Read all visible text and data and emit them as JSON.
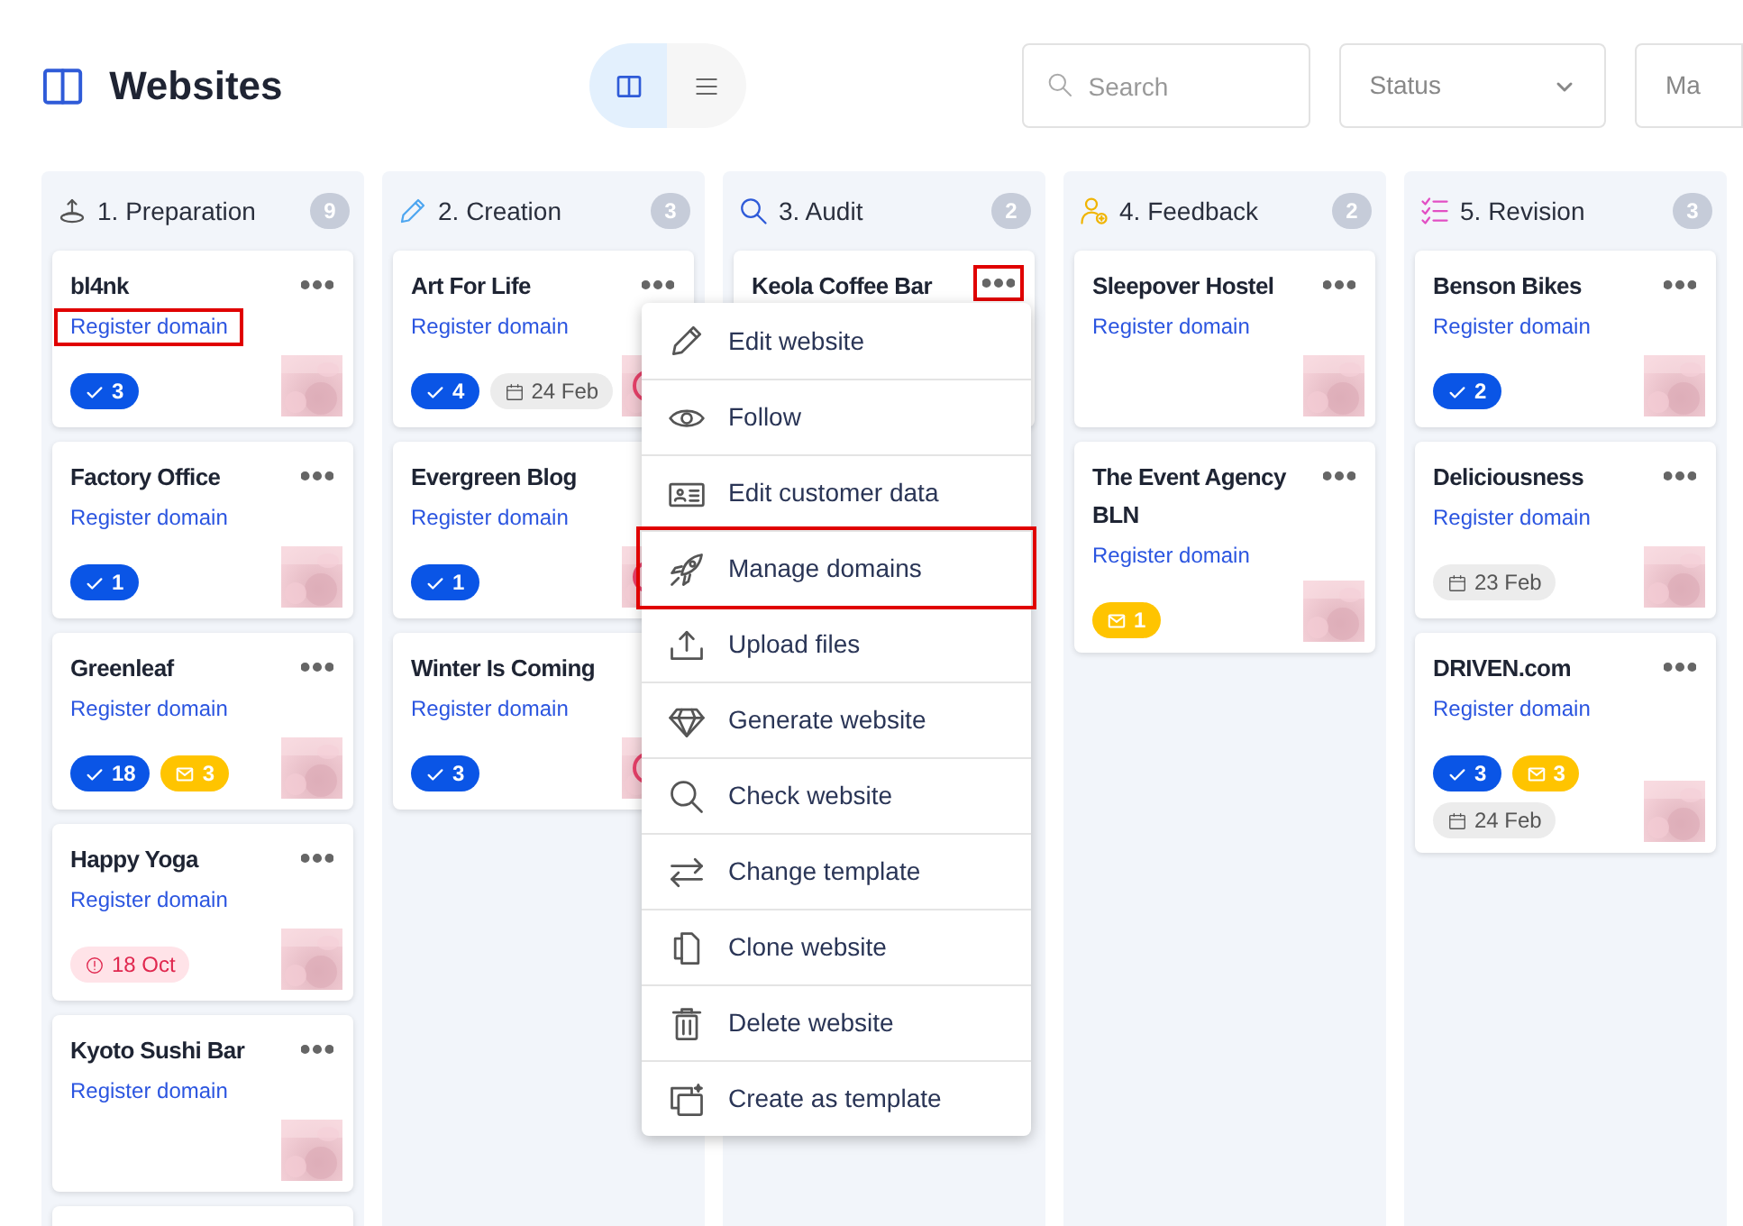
{
  "header": {
    "title": "Websites",
    "view_toggle": [
      {
        "kind": "board",
        "selected": true
      },
      {
        "kind": "list",
        "selected": false
      }
    ],
    "search": {
      "placeholder": "Search"
    },
    "status_filter": {
      "value": "Status"
    },
    "filter_3": {
      "value": "Ma"
    }
  },
  "columns": [
    {
      "title": "1. Preparation",
      "count": "9",
      "cards": [
        {
          "kind": "website",
          "title": "bl4nk",
          "link": "Register domain",
          "link_highlighted": true,
          "badges": [
            {
              "kind": "tasks",
              "text": "3"
            }
          ]
        },
        {
          "kind": "website",
          "title": "Factory Office",
          "link": "Register domain",
          "badges": [
            {
              "kind": "tasks",
              "text": "1"
            }
          ]
        },
        {
          "kind": "website",
          "title": "Greenleaf",
          "link": "Register domain",
          "badges": [
            {
              "kind": "tasks",
              "text": "18"
            },
            {
              "kind": "messages",
              "text": "3"
            }
          ]
        },
        {
          "kind": "website",
          "title": "Happy Yoga",
          "link": "Register domain",
          "badges": [
            {
              "kind": "overdue",
              "text": "18 Oct"
            }
          ]
        },
        {
          "kind": "website",
          "title": "Kyoto Sushi Bar",
          "link": "Register domain"
        },
        {
          "kind": "peek"
        }
      ]
    },
    {
      "title": "2. Creation",
      "count": "3",
      "cards": [
        {
          "kind": "website",
          "title": "Art For Life",
          "link": "Register domain",
          "badges": [
            {
              "kind": "tasks",
              "text": "4"
            },
            {
              "kind": "date",
              "text": "24 Feb"
            }
          ]
        },
        {
          "kind": "website",
          "covered": true,
          "title": "Evergreen Blog",
          "link": "Register domain",
          "badges": [
            {
              "kind": "tasks",
              "text": "1"
            }
          ]
        },
        {
          "kind": "website",
          "covered": true,
          "title": "Winter Is Coming",
          "link": "Register domain",
          "badges": [
            {
              "kind": "tasks",
              "text": "3"
            }
          ]
        }
      ]
    },
    {
      "title": "3. Audit",
      "count": "2",
      "cards": [
        {
          "kind": "website",
          "title": "Keola Coffee Bar",
          "menu_open": true
        }
      ]
    },
    {
      "title": "4. Feedback",
      "count": "2",
      "cards": [
        {
          "kind": "website",
          "title": "Sleepover Hostel",
          "link": "Register domain"
        },
        {
          "kind": "website",
          "title": "The Event Agency BLN",
          "link": "Register domain",
          "badges": [
            {
              "kind": "messages",
              "text": "1"
            }
          ]
        }
      ]
    },
    {
      "title": "5. Revision",
      "count": "3",
      "cards": [
        {
          "kind": "website",
          "title": "Benson Bikes",
          "link": "Register domain",
          "badges": [
            {
              "kind": "tasks",
              "text": "2"
            }
          ]
        },
        {
          "kind": "website",
          "title": "Deliciousness",
          "link": "Register domain",
          "badges": [
            {
              "kind": "date",
              "text": "23 Feb"
            }
          ]
        },
        {
          "kind": "website",
          "title": "DRIVEN.com",
          "link": "Register domain",
          "badges": [
            {
              "kind": "tasks",
              "text": "3"
            },
            {
              "kind": "messages",
              "text": "3"
            },
            {
              "kind": "date",
              "text": "24 Feb"
            }
          ]
        }
      ]
    }
  ],
  "context_menu": {
    "items": [
      {
        "label": "Edit website",
        "highlighted": false
      },
      {
        "label": "Follow",
        "highlighted": false
      },
      {
        "label": "Edit customer data",
        "highlighted": false
      },
      {
        "label": "Manage domains",
        "highlighted": true
      },
      {
        "label": "Upload files",
        "highlighted": false
      },
      {
        "label": "Generate website",
        "highlighted": false
      },
      {
        "label": "Check website",
        "highlighted": false
      },
      {
        "label": "Change template",
        "highlighted": false
      },
      {
        "label": "Clone website",
        "highlighted": false
      },
      {
        "label": "Delete website",
        "highlighted": false
      },
      {
        "label": "Create as template",
        "highlighted": false
      }
    ]
  }
}
